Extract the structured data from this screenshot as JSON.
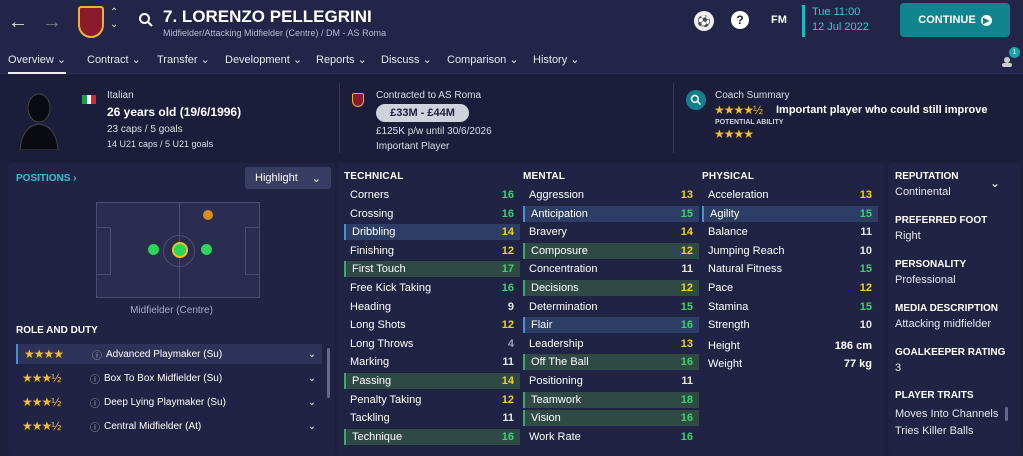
{
  "header": {
    "title": "7. LORENZO PELLEGRINI",
    "subtitle": "Midfielder/Attacking Midfielder (Centre) / DM - AS Roma",
    "time": "Tue 11:00",
    "date": "12 Jul 2022",
    "continue_label": "CONTINUE",
    "fm_label": "FM",
    "help_label": "?",
    "notif_count": "1"
  },
  "tabs": [
    "Overview",
    "Contract",
    "Transfer",
    "Development",
    "Reports",
    "Discuss",
    "Comparison",
    "History"
  ],
  "bio": {
    "nationality": "Italian",
    "age": "26 years old (19/6/1996)",
    "caps": "23 caps / 5 goals",
    "u21": "14 U21 caps / 5 U21 goals"
  },
  "contract": {
    "title": "Contracted to AS Roma",
    "value": "£33M - £44M",
    "wage": "£125K p/w until 30/6/2026",
    "status": "Important Player"
  },
  "coach": {
    "title": "Coach Summary",
    "summary": "Important player who could still improve",
    "potential_label": "POTENTIAL ABILITY"
  },
  "positions": {
    "title": "POSITIONS",
    "highlight_label": "Highlight",
    "position_name": "Midfielder (Centre)"
  },
  "role": {
    "title": "ROLE AND DUTY",
    "items": [
      {
        "name": "Advanced Playmaker (Su)",
        "stars": "★★★★"
      },
      {
        "name": "Box To Box Midfielder (Su)",
        "stars": "★★★½"
      },
      {
        "name": "Deep Lying Playmaker (Su)",
        "stars": "★★★½"
      },
      {
        "name": "Central Midfielder (At)",
        "stars": "★★★½"
      }
    ]
  },
  "technical": {
    "title": "TECHNICAL",
    "rows": [
      {
        "k": "Corners",
        "v": "16"
      },
      {
        "k": "Crossing",
        "v": "16"
      },
      {
        "k": "Dribbling",
        "v": "14"
      },
      {
        "k": "Finishing",
        "v": "12"
      },
      {
        "k": "First Touch",
        "v": "17"
      },
      {
        "k": "Free Kick Taking",
        "v": "16"
      },
      {
        "k": "Heading",
        "v": "9"
      },
      {
        "k": "Long Shots",
        "v": "12"
      },
      {
        "k": "Long Throws",
        "v": "4"
      },
      {
        "k": "Marking",
        "v": "11"
      },
      {
        "k": "Passing",
        "v": "14"
      },
      {
        "k": "Penalty Taking",
        "v": "12"
      },
      {
        "k": "Tackling",
        "v": "11"
      },
      {
        "k": "Technique",
        "v": "16"
      }
    ]
  },
  "mental": {
    "title": "MENTAL",
    "rows": [
      {
        "k": "Aggression",
        "v": "13"
      },
      {
        "k": "Anticipation",
        "v": "15"
      },
      {
        "k": "Bravery",
        "v": "14"
      },
      {
        "k": "Composure",
        "v": "12"
      },
      {
        "k": "Concentration",
        "v": "11"
      },
      {
        "k": "Decisions",
        "v": "12"
      },
      {
        "k": "Determination",
        "v": "15"
      },
      {
        "k": "Flair",
        "v": "16"
      },
      {
        "k": "Leadership",
        "v": "13"
      },
      {
        "k": "Off The Ball",
        "v": "16"
      },
      {
        "k": "Positioning",
        "v": "11"
      },
      {
        "k": "Teamwork",
        "v": "18"
      },
      {
        "k": "Vision",
        "v": "16"
      },
      {
        "k": "Work Rate",
        "v": "16"
      }
    ]
  },
  "physical": {
    "title": "PHYSICAL",
    "rows": [
      {
        "k": "Acceleration",
        "v": "13"
      },
      {
        "k": "Agility",
        "v": "15"
      },
      {
        "k": "Balance",
        "v": "11"
      },
      {
        "k": "Jumping Reach",
        "v": "10"
      },
      {
        "k": "Natural Fitness",
        "v": "15"
      },
      {
        "k": "Pace",
        "v": "12"
      },
      {
        "k": "Stamina",
        "v": "15"
      },
      {
        "k": "Strength",
        "v": "10"
      }
    ],
    "height_label": "Height",
    "height": "186 cm",
    "weight_label": "Weight",
    "weight": "77 kg"
  },
  "right": {
    "reputation_label": "REPUTATION",
    "reputation": "Continental",
    "foot_label": "PREFERRED FOOT",
    "foot": "Right",
    "personality_label": "PERSONALITY",
    "personality": "Professional",
    "media_label": "MEDIA DESCRIPTION",
    "media": "Attacking midfielder",
    "gk_label": "GOALKEEPER RATING",
    "gk": "3",
    "traits_label": "PLAYER TRAITS",
    "trait1": "Moves Into Channels",
    "trait2": "Tries Killer Balls"
  },
  "colors": {
    "accent": "#13a6b0",
    "green": "#39d36d",
    "yellow": "#f2d21c",
    "bg": "#1d1f3d"
  }
}
